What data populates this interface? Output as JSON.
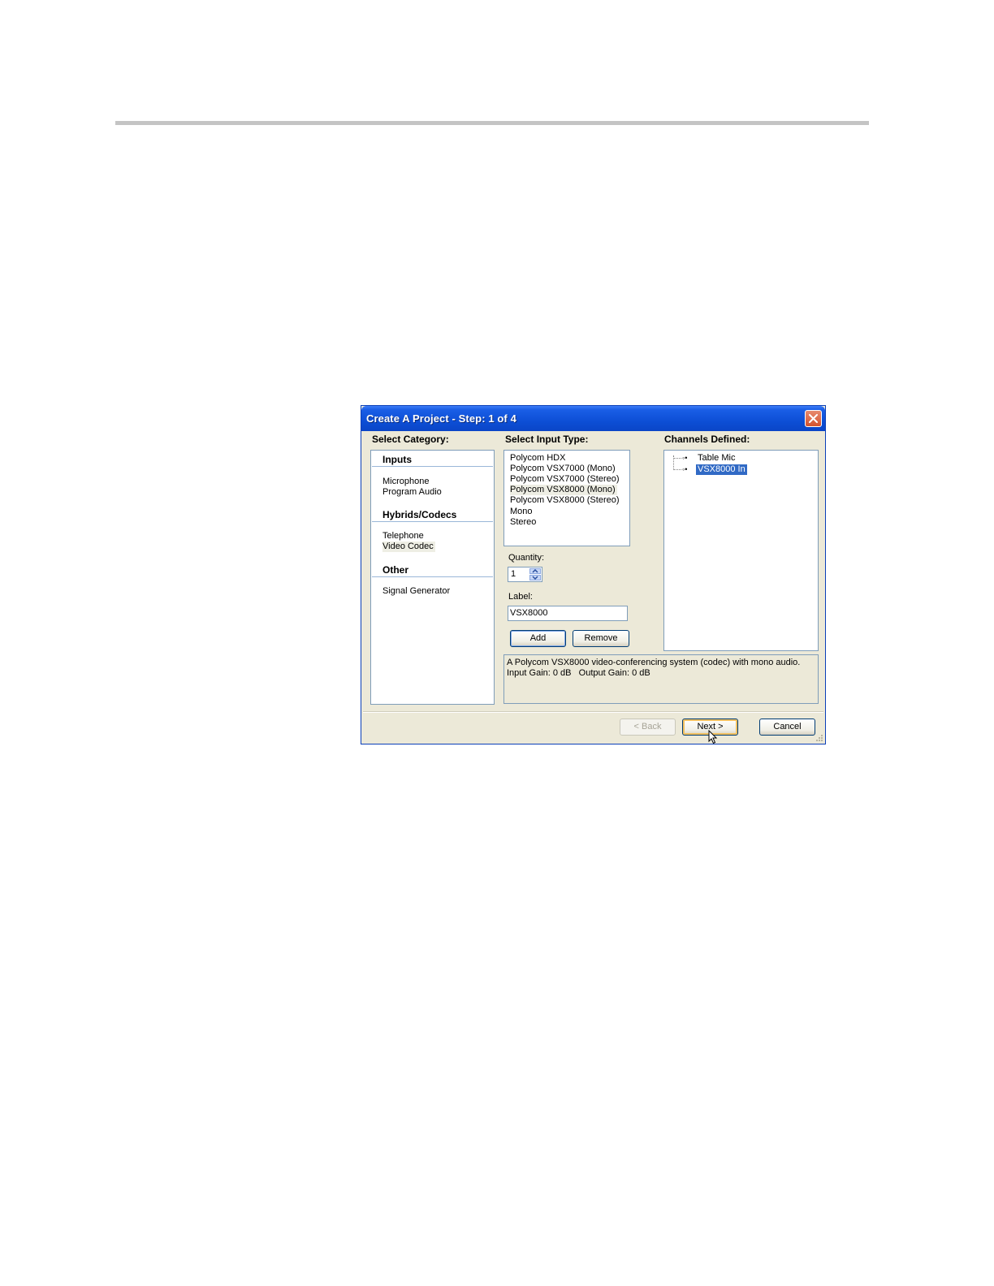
{
  "window": {
    "title": "Create A Project - Step: 1 of 4"
  },
  "category": {
    "label": "Select Category:",
    "groups": [
      {
        "name": "Inputs",
        "items": [
          "Microphone",
          "Program Audio"
        ]
      },
      {
        "name": "Hybrids/Codecs",
        "items": [
          "Telephone",
          "Video Codec"
        ]
      },
      {
        "name": "Other",
        "items": [
          "Signal Generator"
        ]
      }
    ],
    "selected": "Video Codec"
  },
  "input_type": {
    "label": "Select Input Type:",
    "items": [
      "Polycom HDX",
      "Polycom VSX7000 (Mono)",
      "Polycom VSX7000 (Stereo)",
      "Polycom VSX8000 (Mono)",
      "Polycom VSX8000 (Stereo)",
      "Mono",
      "Stereo"
    ],
    "selected": "Polycom VSX8000 (Mono)"
  },
  "quantity": {
    "label": "Quantity:",
    "value": "1"
  },
  "label_field": {
    "label": "Label:",
    "value": "VSX8000"
  },
  "buttons": {
    "add": "Add",
    "remove": "Remove",
    "back": "< Back",
    "next": "Next >",
    "cancel": "Cancel"
  },
  "channels": {
    "label": "Channels Defined:",
    "items": [
      "Table Mic",
      "VSX8000 In"
    ],
    "selected": "VSX8000 In"
  },
  "description": {
    "line1": "A Polycom VSX8000 video-conferencing system (codec) with mono audio.",
    "line2": "Input Gain: 0 dB   Output Gain: 0 dB"
  },
  "colors": {
    "title_bar": "#0d4fd6",
    "selection": "#316ac5",
    "dialog_bg": "#ece9d8"
  }
}
